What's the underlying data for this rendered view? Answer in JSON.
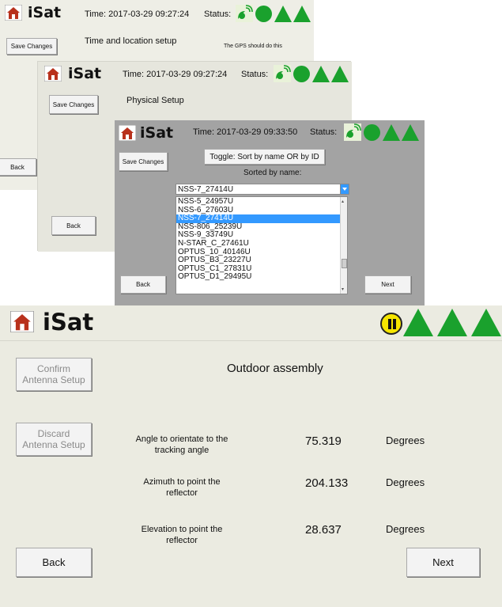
{
  "app": {
    "brand": "iSat"
  },
  "window1": {
    "time": "Time: 2017-03-29 09:27:24",
    "status_label": "Status:",
    "save_label": "Save Changes",
    "title": "Time and location setup",
    "gps_note": "The GPS should do this",
    "back_label": "Back"
  },
  "window2": {
    "time": "Time: 2017-03-29 09:27:24",
    "status_label": "Status:",
    "save_label": "Save Changes",
    "title": "Physical Setup",
    "back_label": "Back"
  },
  "window3": {
    "time": "Time: 2017-03-29 09:33:50",
    "status_label": "Status:",
    "save_label": "Save Changes",
    "toggle_label": "Toggle: Sort by name OR by ID",
    "sorted_label": "Sorted by name:",
    "dropdown_value": "NSS-7_27414U",
    "list_items": [
      "NSS-5_24957U",
      "NSS-6_27603U",
      "NSS-7_27414U",
      "NSS-806_25239U",
      "NSS-9_33749U",
      "N-STAR_C_27461U",
      "OPTUS_10_40146U",
      "OPTUS_B3_23227U",
      "OPTUS_C1_27831U",
      "OPTUS_D1_29495U"
    ],
    "selected_item": "NSS-7_27414U",
    "back_label": "Back",
    "next_label": "Next"
  },
  "window4": {
    "confirm_label_1": "Confirm",
    "confirm_label_2": "Antenna Setup",
    "discard_label_1": "Discard",
    "discard_label_2": "Antenna Setup",
    "title": "Outdoor assembly",
    "rows": [
      {
        "label_1": "Angle to orientate to the",
        "label_2": "tracking angle",
        "value": "75.319",
        "unit": "Degrees"
      },
      {
        "label_1": "Azimuth to point the",
        "label_2": "reflector",
        "value": "204.133",
        "unit": "Degrees"
      },
      {
        "label_1": "Elevation to point the",
        "label_2": "reflector",
        "value": "28.637",
        "unit": "Degrees"
      }
    ],
    "back_label": "Back",
    "next_label": "Next"
  },
  "colors": {
    "status_green": "#1aa12d",
    "pause_yellow": "#f5e500",
    "selection_blue": "#3399ff",
    "icon_red": "#c8402a"
  },
  "icons": [
    "home-icon",
    "satellite-signal-icon",
    "status-circle-icon",
    "status-triangle-icon",
    "pause-icon",
    "dropdown-arrow-icon"
  ]
}
